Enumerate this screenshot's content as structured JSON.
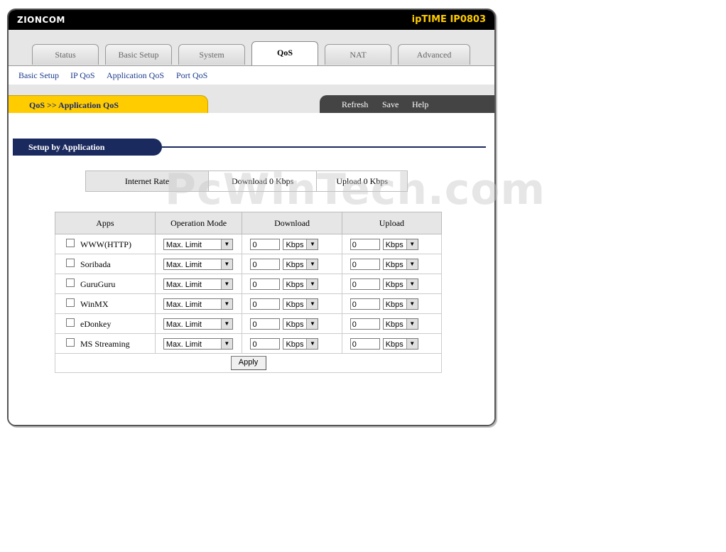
{
  "header": {
    "brand": "ZIONCOM",
    "model": "ipTIME IP0803"
  },
  "tabs": [
    {
      "label": "Status"
    },
    {
      "label": "Basic Setup"
    },
    {
      "label": "System"
    },
    {
      "label": "QoS",
      "active": true
    },
    {
      "label": "NAT"
    },
    {
      "label": "Advanced"
    }
  ],
  "subnav": [
    "Basic Setup",
    "IP QoS",
    "Application QoS",
    "Port QoS"
  ],
  "breadcrumb": "QoS >> Application QoS",
  "actions": {
    "refresh": "Refresh",
    "save": "Save",
    "help": "Help"
  },
  "section_title": "Setup by Application",
  "rate": {
    "label": "Internet Rate",
    "download": "Download 0 Kbps",
    "upload": "Upload 0 Kbps"
  },
  "table": {
    "headers": {
      "apps": "Apps",
      "mode": "Operation Mode",
      "download": "Download",
      "upload": "Upload"
    },
    "rows": [
      {
        "app": "WWW(HTTP)",
        "mode": "Max. Limit",
        "dl": "0",
        "dl_unit": "Kbps",
        "ul": "0",
        "ul_unit": "Kbps"
      },
      {
        "app": "Soribada",
        "mode": "Max. Limit",
        "dl": "0",
        "dl_unit": "Kbps",
        "ul": "0",
        "ul_unit": "Kbps"
      },
      {
        "app": "GuruGuru",
        "mode": "Max. Limit",
        "dl": "0",
        "dl_unit": "Kbps",
        "ul": "0",
        "ul_unit": "Kbps"
      },
      {
        "app": "WinMX",
        "mode": "Max. Limit",
        "dl": "0",
        "dl_unit": "Kbps",
        "ul": "0",
        "ul_unit": "Kbps"
      },
      {
        "app": "eDonkey",
        "mode": "Max. Limit",
        "dl": "0",
        "dl_unit": "Kbps",
        "ul": "0",
        "ul_unit": "Kbps"
      },
      {
        "app": "MS Streaming",
        "mode": "Max. Limit",
        "dl": "0",
        "dl_unit": "Kbps",
        "ul": "0",
        "ul_unit": "Kbps"
      }
    ],
    "apply": "Apply"
  },
  "watermark": "PcWinTech.com",
  "colors": {
    "accent_yellow": "#ffcc00",
    "navy": "#1b2a5e",
    "link": "#1a3b8c"
  }
}
